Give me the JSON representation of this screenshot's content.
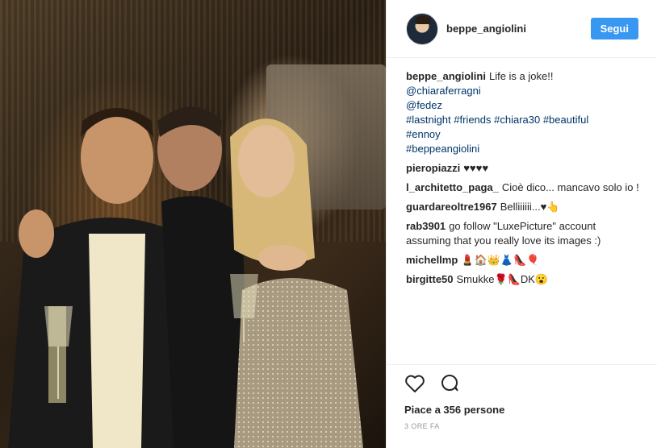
{
  "post": {
    "username": "beppe_angiolini",
    "follow_label": "Segui",
    "caption": {
      "user": "beppe_angiolini",
      "text": "Life is a joke!!",
      "mentions": [
        "@chiaraferragni",
        "@fedez"
      ],
      "hashtags_line1": "#lastnight #friends #chiara30 #beautiful",
      "hashtags_line2": "#ennoy",
      "hashtags_line3": "#beppeangiolini"
    },
    "comments": [
      {
        "user": "pieropiazzi",
        "text": "♥♥♥♥"
      },
      {
        "user": "l_architetto_paga_",
        "text": "Cioè dico... mancavo solo io !"
      },
      {
        "user": "guardareoltre1967",
        "text": "Belliiiiii...♥👆"
      },
      {
        "user": "rab3901",
        "text": "go follow \"LuxePicture\" account assuming that you really love its images :)"
      },
      {
        "user": "michellmp",
        "text": "💄🏠👑👗👠🎈"
      },
      {
        "user": "birgitte50",
        "text": "Smukke🌹👠DK😮"
      }
    ],
    "likes_text": "Piace a 356 persone",
    "time_text": "3 ORE FA"
  },
  "icons": {
    "like": "heart-icon",
    "comment": "comment-icon"
  },
  "colors": {
    "follow_button": "#3897f0",
    "hashtag": "#003569",
    "border": "#efefef"
  }
}
